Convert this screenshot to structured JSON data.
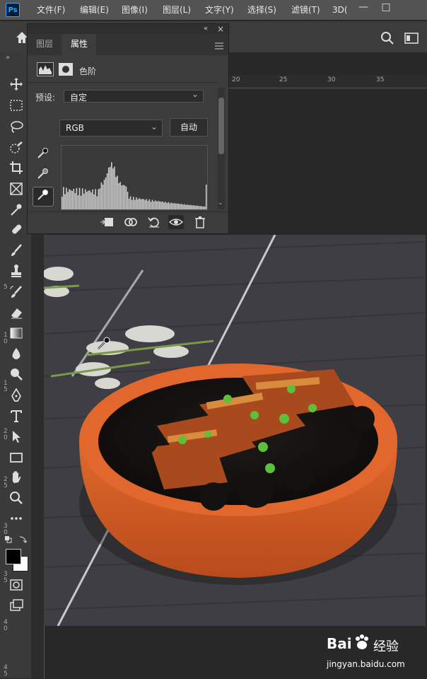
{
  "app": {
    "logo": "Ps"
  },
  "menu": [
    "文件(F)",
    "编辑(E)",
    "图像(I)",
    "图层(L)",
    "文字(Y)",
    "选择(S)",
    "滤镜(T)",
    "3D("
  ],
  "window_controls": [
    "—",
    "□"
  ],
  "panel": {
    "tabs": [
      "图层",
      "属性"
    ],
    "title": "色阶",
    "preset_label": "预设:",
    "preset_value": "自定",
    "channel": "RGB",
    "auto_label": "自动"
  },
  "ruler_top": [
    "20",
    "25",
    "30",
    "35"
  ],
  "ruler_left": [
    "5",
    "1\n0",
    "1\n5",
    "2\n0",
    "2\n5",
    "3\n0",
    "3\n5",
    "4\n0",
    "4\n5"
  ],
  "watermark": {
    "brand": "Bai",
    "brand2": "经验",
    "url": "jingyan.baidu.com"
  },
  "icons": [
    "home-icon",
    "search-icon",
    "workspace-icon",
    "move-icon",
    "marquee-icon",
    "lasso-icon",
    "quick-select-icon",
    "crop-icon",
    "frame-icon",
    "eyedropper-icon",
    "healing-icon",
    "brush-icon",
    "stamp-icon",
    "history-brush-icon",
    "eraser-icon",
    "gradient-icon",
    "blur-icon",
    "dodge-icon",
    "pen-icon",
    "type-icon",
    "path-select-icon",
    "rectangle-icon",
    "hand-icon",
    "zoom-icon"
  ],
  "colors": {
    "accent": "#31a8ff",
    "bowl": "#d9622a",
    "table": "#3f3f45"
  }
}
